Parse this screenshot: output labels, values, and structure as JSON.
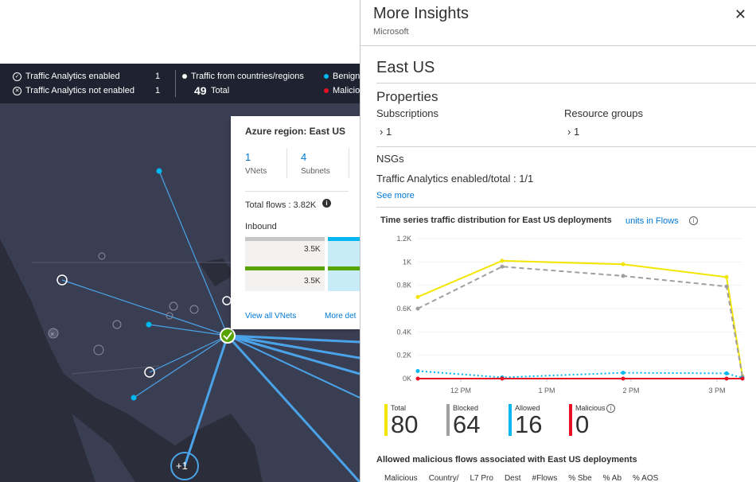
{
  "stats": {
    "enabled_label": "Traffic Analytics enabled",
    "enabled_count": "1",
    "not_enabled_label": "Traffic Analytics not enabled",
    "not_enabled_count": "1",
    "countries_label": "Traffic from countries/regions",
    "total_value": "49",
    "total_label": "Total",
    "benign_label": "Benign",
    "malicious_label": "Malicio"
  },
  "popup": {
    "title": "Azure region: East US",
    "vnets_value": "1",
    "vnets_label": "VNets",
    "subnets_value": "4",
    "subnets_label": "Subnets",
    "total_flows": "Total flows : 3.82K",
    "inbound_label": "Inbound",
    "bar_value_1": "3.5K",
    "bar_value_2": "3.5K",
    "view_all_link": "View all VNets",
    "more_link": "More det"
  },
  "map": {
    "cluster_label": "+1"
  },
  "panel": {
    "title": "More Insights",
    "subtitle": "Microsoft",
    "region": "East US",
    "properties_heading": "Properties",
    "subscriptions_label": "Subscriptions",
    "subscriptions_value": "1",
    "resource_groups_label": "Resource groups",
    "resource_groups_value": "1",
    "nsgs_heading": "NSGs",
    "nsgs_text": "Traffic Analytics enabled/total : 1/1",
    "see_more": "See more",
    "chart_title": "Time series traffic distribution for East US deployments",
    "chart_units": "units in Flows",
    "legend": [
      {
        "label": "Total",
        "value": "80",
        "color": "#f2e600"
      },
      {
        "label": "Blocked",
        "value": "64",
        "color": "#a19f9d"
      },
      {
        "label": "Allowed",
        "value": "16",
        "color": "#00b7f1"
      },
      {
        "label": "Malicious",
        "value": "0",
        "color": "#e81123"
      }
    ],
    "malicious_heading": "Allowed malicious flows associated with East US deployments",
    "table_headers": [
      "Malicious",
      "Country/",
      "L7 Pro",
      "Dest",
      "#Flows",
      "% Sbe",
      "% Ab",
      "% AOS"
    ]
  },
  "chart_data": {
    "type": "line",
    "x": [
      "11:30 AM",
      "1:20 PM",
      "2:20 PM",
      "3:20 PM",
      "3:55 PM"
    ],
    "xticks": [
      "12 PM",
      "1 PM",
      "2 PM",
      "3 PM"
    ],
    "yticks": [
      "0K",
      "0.2K",
      "0.4K",
      "0.6K",
      "0.8K",
      "1K",
      "1.2K"
    ],
    "ylim": [
      0,
      1200
    ],
    "series": [
      {
        "name": "Total",
        "color": "#f2e600",
        "style": "solid",
        "values": [
          700,
          1010,
          980,
          870,
          20
        ]
      },
      {
        "name": "Blocked",
        "color": "#a19f9d",
        "style": "dashed",
        "values": [
          600,
          960,
          880,
          790,
          15
        ]
      },
      {
        "name": "Allowed",
        "color": "#00b7f1",
        "style": "dotted",
        "values": [
          65,
          10,
          50,
          45,
          5
        ]
      },
      {
        "name": "Malicious",
        "color": "#e81123",
        "style": "solid",
        "values": [
          0,
          0,
          0,
          0,
          0
        ]
      }
    ]
  }
}
